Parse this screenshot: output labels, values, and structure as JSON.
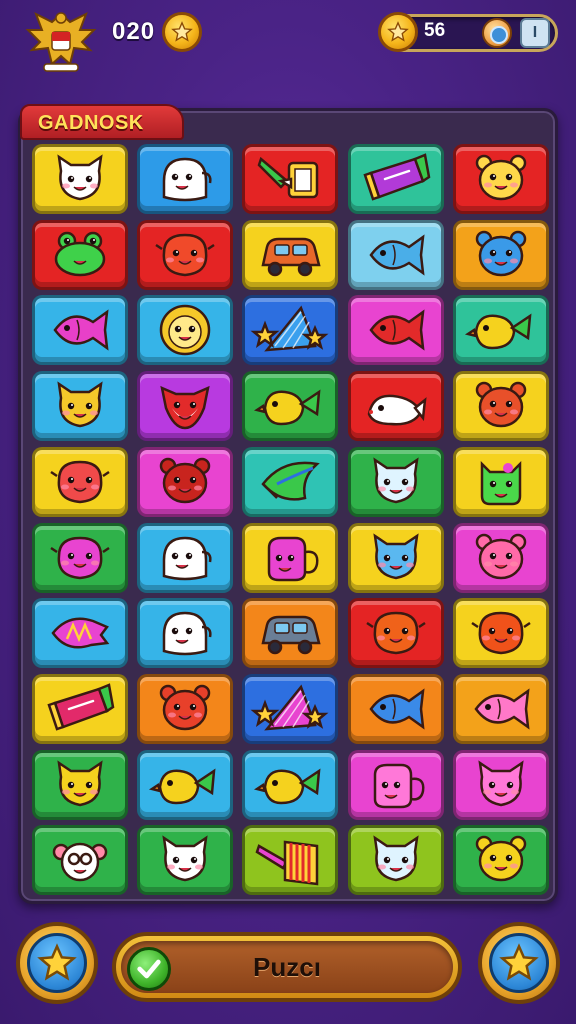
{
  "hud": {
    "left_count": "020",
    "currency_value": "56",
    "menu_icon_label": "I"
  },
  "board": {
    "title": "GADNOSK",
    "rows": [
      [
        {
          "color": "#f5d21e",
          "icon": "cat-face-icon",
          "creature": "#ffffff"
        },
        {
          "color": "#2d9be8",
          "icon": "ghost-face-icon",
          "creature": "#ffffff"
        },
        {
          "color": "#e42424",
          "icon": "hammer-flag-icon",
          "creature": "#ffd23a"
        },
        {
          "color": "#2fc39a",
          "icon": "candy-bar-icon",
          "creature": "#b23ad8"
        },
        {
          "color": "#e42424",
          "icon": "bear-face-icon",
          "creature": "#ffd84a"
        }
      ],
      [
        {
          "color": "#e42424",
          "icon": "frog-face-icon",
          "creature": "#3fd14a"
        },
        {
          "color": "#e42424",
          "icon": "blob-face-icon",
          "creature": "#f04a2a"
        },
        {
          "color": "#f5d21e",
          "icon": "car-icon",
          "creature": "#e8682a"
        },
        {
          "color": "#7ed0ee",
          "icon": "fish-icon",
          "creature": "#4aaee8"
        },
        {
          "color": "#f3a21a",
          "icon": "bear-face-icon",
          "creature": "#3a9ae8"
        }
      ],
      [
        {
          "color": "#36b4e8",
          "icon": "fish-icon",
          "creature": "#e840c8"
        },
        {
          "color": "#36b4e8",
          "icon": "lion-face-icon",
          "creature": "#f5c82a"
        },
        {
          "color": "#2d6fe0",
          "icon": "star-fan-icon",
          "creature": "#3aa0ee"
        },
        {
          "color": "#e844d0",
          "icon": "fish-icon",
          "creature": "#e22a2a"
        },
        {
          "color": "#2fc39a",
          "icon": "duck-icon",
          "creature": "#f5d21e"
        }
      ],
      [
        {
          "color": "#36b4e8",
          "icon": "cat-face-icon",
          "creature": "#f5c82a"
        },
        {
          "color": "#b83ae0",
          "icon": "fox-face-icon",
          "creature": "#e22a2a"
        },
        {
          "color": "#2fb24a",
          "icon": "bird-icon",
          "creature": "#f5d21e"
        },
        {
          "color": "#e42424",
          "icon": "seal-icon",
          "creature": "#ffffff"
        },
        {
          "color": "#f5d21e",
          "icon": "bear-face-icon",
          "creature": "#e8502a"
        }
      ],
      [
        {
          "color": "#f5d21e",
          "icon": "blob-face-icon",
          "creature": "#f04a4a"
        },
        {
          "color": "#e844d0",
          "icon": "bear-face-icon",
          "creature": "#c8241e"
        },
        {
          "color": "#2fc3b4",
          "icon": "feather-icon",
          "creature": "#3ac84a"
        },
        {
          "color": "#2fb24a",
          "icon": "cat-face-icon",
          "creature": "#dff4ff"
        },
        {
          "color": "#f5d21e",
          "icon": "monster-icon",
          "creature": "#4ad84a"
        }
      ],
      [
        {
          "color": "#2fb24a",
          "icon": "blob-face-icon",
          "creature": "#e844d0"
        },
        {
          "color": "#36b4e8",
          "icon": "ghost-face-icon",
          "creature": "#ffffff"
        },
        {
          "color": "#f5d21e",
          "icon": "teapot-icon",
          "creature": "#e844d0"
        },
        {
          "color": "#f5d21e",
          "icon": "cat-face-icon",
          "creature": "#5ab8f0"
        },
        {
          "color": "#e844d0",
          "icon": "bear-face-icon",
          "creature": "#ff6aa8"
        }
      ],
      [
        {
          "color": "#36b4e8",
          "icon": "candy-icon",
          "creature": "#e844d0"
        },
        {
          "color": "#36b4e8",
          "icon": "ghost-face-icon",
          "creature": "#ffffff"
        },
        {
          "color": "#f3861a",
          "icon": "car-icon",
          "creature": "#6a7e96"
        },
        {
          "color": "#e42424",
          "icon": "blob-face-icon",
          "creature": "#f0621a"
        },
        {
          "color": "#f5d21e",
          "icon": "blob-face-icon",
          "creature": "#f0521a"
        }
      ],
      [
        {
          "color": "#f5d21e",
          "icon": "candy-bar-icon",
          "creature": "#e22a6a"
        },
        {
          "color": "#f3861a",
          "icon": "bear-face-icon",
          "creature": "#e8402a"
        },
        {
          "color": "#2d6fe0",
          "icon": "star-fan-icon",
          "creature": "#e844d0"
        },
        {
          "color": "#f3861a",
          "icon": "fish-icon",
          "creature": "#3a8ae8"
        },
        {
          "color": "#f3a21a",
          "icon": "fish-icon",
          "creature": "#ff78c8"
        }
      ],
      [
        {
          "color": "#2fb24a",
          "icon": "cat-face-icon",
          "creature": "#f5d21e"
        },
        {
          "color": "#36b4e8",
          "icon": "duck-icon",
          "creature": "#f5d21e"
        },
        {
          "color": "#36b4e8",
          "icon": "bird-icon",
          "creature": "#f5d21e"
        },
        {
          "color": "#e844d0",
          "icon": "teapot-icon",
          "creature": "#ff78d8"
        },
        {
          "color": "#e844d0",
          "icon": "cat-face-icon",
          "creature": "#ff78d8"
        }
      ],
      [
        {
          "color": "#2fb24a",
          "icon": "sheep-face-icon",
          "creature": "#ffffff"
        },
        {
          "color": "#2fb24a",
          "icon": "cat-face-icon",
          "creature": "#ffffff"
        },
        {
          "color": "#8fc41e",
          "icon": "xylophone-icon",
          "creature": "#e844d0"
        },
        {
          "color": "#8fc41e",
          "icon": "cat-face-icon",
          "creature": "#dff4ff"
        },
        {
          "color": "#2fb24a",
          "icon": "bear-face-icon",
          "creature": "#f5d21e"
        }
      ]
    ]
  },
  "bottom": {
    "main_button_label": "Puzcı",
    "left_button_icon": "star-icon",
    "right_button_icon": "star-icon"
  }
}
